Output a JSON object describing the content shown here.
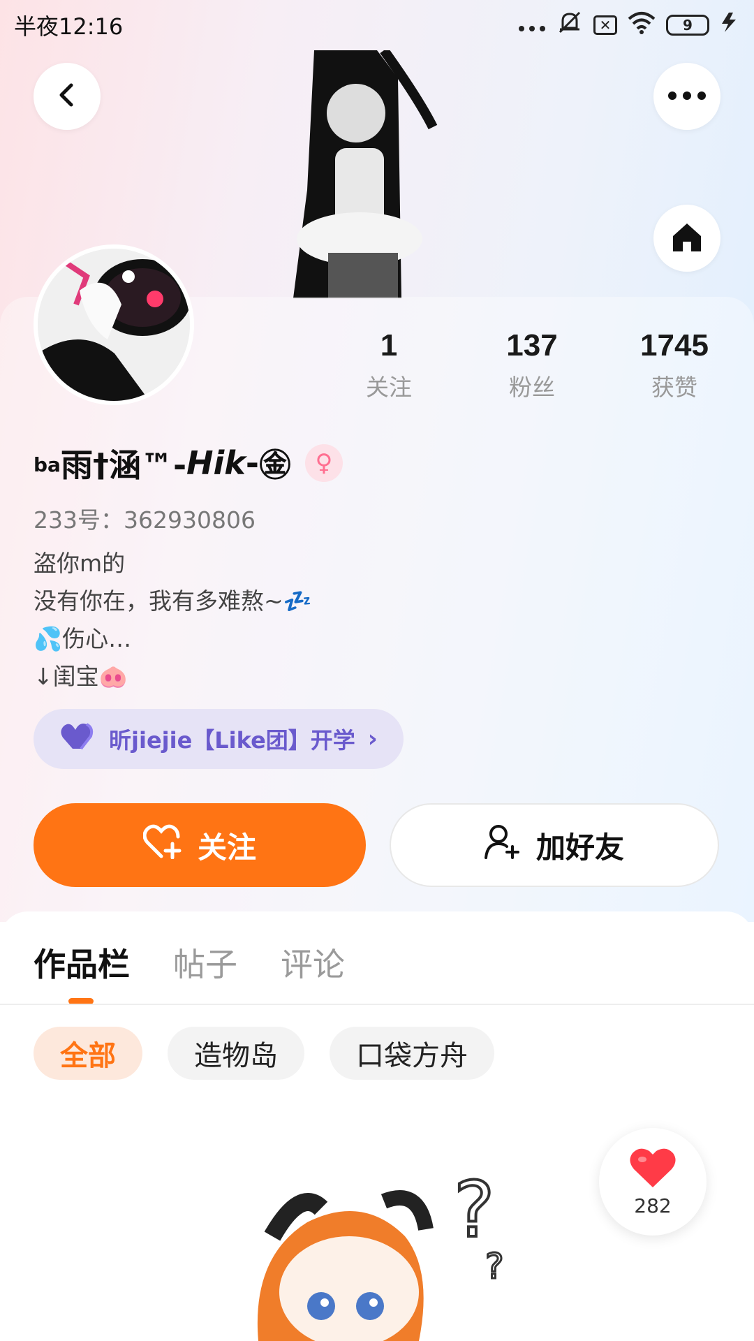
{
  "status_bar": {
    "time": "半夜12:16",
    "battery": "9",
    "icons": [
      "dots-icon",
      "mute-icon",
      "x-box-icon",
      "wifi-icon",
      "battery-icon",
      "charging-icon"
    ]
  },
  "header": {
    "back_icon": "back-arrow-icon",
    "more_icon": "more-icon",
    "home_icon": "home-icon"
  },
  "profile": {
    "stats": [
      {
        "value": "1",
        "label": "关注"
      },
      {
        "value": "137",
        "label": "粉丝"
      },
      {
        "value": "1745",
        "label": "获赞"
      }
    ],
    "username_prefix": "ba",
    "username_main": "雨†涵™-",
    "username_italic": "Hik",
    "username_suffix": "-",
    "username_badge": "㊎",
    "gender_icon": "♀",
    "uid": "233号：362930806",
    "bio_lines": [
      "盗你m的",
      "没有你在，我有多难熬~💤",
      "💦伤心…",
      "↓闺宝🐽"
    ],
    "group": {
      "label": "昕jiejie【Like团】开学",
      "icon": "heart-icon",
      "chevron": "›"
    }
  },
  "actions": {
    "follow_label": "关注",
    "add_friend_label": "加好友"
  },
  "tabs": [
    "作品栏",
    "帖子",
    "评论"
  ],
  "active_tab": "作品栏",
  "filters": [
    "全部",
    "造物岛",
    "口袋方舟"
  ],
  "active_filter": "全部",
  "likes": {
    "count": "282"
  },
  "colors": {
    "accent": "#ff7414",
    "group_text": "#6a5acd",
    "gender": "#ff6f91"
  }
}
